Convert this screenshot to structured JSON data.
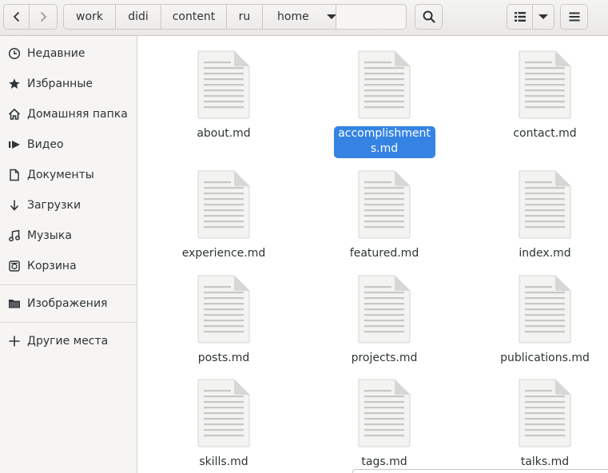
{
  "toolbar": {
    "back_icon": "go-back-icon",
    "forward_icon": "go-forward-icon",
    "search_icon": "search-icon",
    "view_list_icon": "view-list-icon",
    "view_options_icon": "chevron-down-icon",
    "menu_icon": "hamburger-menu-icon"
  },
  "pathbar": {
    "crumbs": [
      "work",
      "didi",
      "content",
      "ru",
      "home"
    ]
  },
  "sidebar": {
    "items": [
      {
        "label": "Недавние",
        "icon": "clock-icon"
      },
      {
        "label": "Избранные",
        "icon": "star-icon"
      },
      {
        "label": "Домашняя папка",
        "icon": "home-icon"
      },
      {
        "label": "Видео",
        "icon": "video-icon"
      },
      {
        "label": "Документы",
        "icon": "document-icon"
      },
      {
        "label": "Загрузки",
        "icon": "download-icon"
      },
      {
        "label": "Музыка",
        "icon": "music-icon"
      },
      {
        "label": "Корзина",
        "icon": "trash-icon"
      },
      {
        "label": "Изображения",
        "icon": "folder-icon"
      },
      {
        "label": "Другие места",
        "icon": "plus-icon"
      }
    ]
  },
  "files": [
    {
      "name": "about.md",
      "selected": false
    },
    {
      "name": "accomplishments.md",
      "selected": true
    },
    {
      "name": "contact.md",
      "selected": false
    },
    {
      "name": "experience.md",
      "selected": false
    },
    {
      "name": "featured.md",
      "selected": false
    },
    {
      "name": "index.md",
      "selected": false
    },
    {
      "name": "posts.md",
      "selected": false
    },
    {
      "name": "projects.md",
      "selected": false
    },
    {
      "name": "publications.md",
      "selected": false
    },
    {
      "name": "skills.md",
      "selected": false
    },
    {
      "name": "tags.md",
      "selected": false
    },
    {
      "name": "talks.md",
      "selected": false
    }
  ],
  "colors": {
    "selection": "#3584e4",
    "sidebar_bg": "#f6f5f4",
    "text": "#2e3436"
  }
}
